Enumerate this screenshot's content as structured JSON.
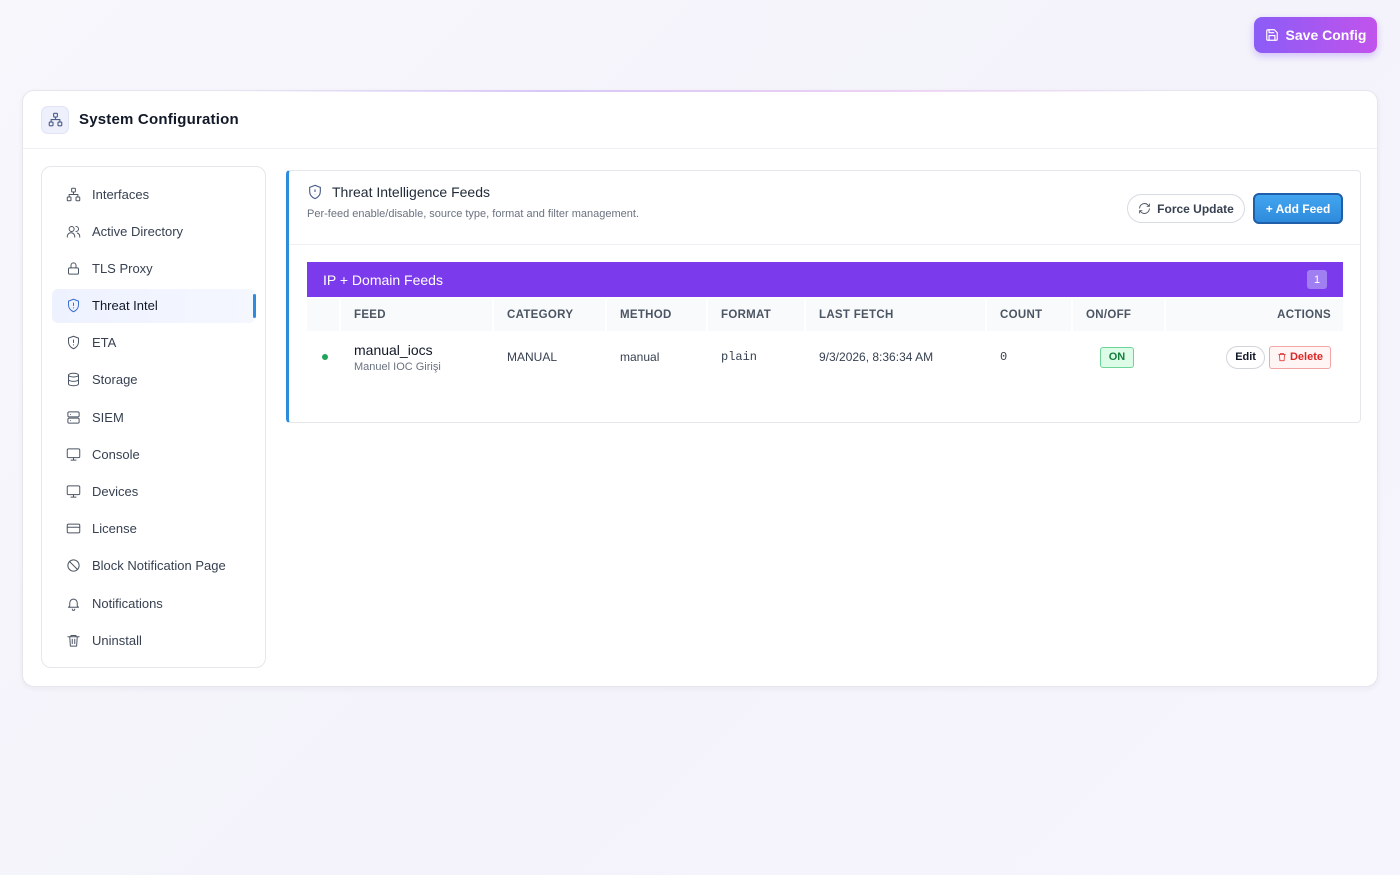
{
  "toolbar": {
    "save_label": "Save Config"
  },
  "card": {
    "title": "System Configuration"
  },
  "sidebar": {
    "items": [
      {
        "label": "Interfaces",
        "icon": "network-icon"
      },
      {
        "label": "Active Directory",
        "icon": "users-icon"
      },
      {
        "label": "TLS Proxy",
        "icon": "lock-icon"
      },
      {
        "label": "Threat Intel",
        "icon": "shield-icon",
        "active": true
      },
      {
        "label": "ETA",
        "icon": "shield-alert-icon"
      },
      {
        "label": "Storage",
        "icon": "database-icon"
      },
      {
        "label": "SIEM",
        "icon": "server-icon"
      },
      {
        "label": "Console",
        "icon": "monitor-icon"
      },
      {
        "label": "Devices",
        "icon": "monitor-icon"
      },
      {
        "label": "License",
        "icon": "credit-card-icon"
      },
      {
        "label": "Block Notification Page",
        "icon": "ban-icon"
      },
      {
        "label": "Notifications",
        "icon": "bell-icon"
      },
      {
        "label": "Uninstall",
        "icon": "trash-icon"
      }
    ]
  },
  "panel": {
    "title": "Threat Intelligence Feeds",
    "subtitle": "Per-feed enable/disable, source type, format and filter management.",
    "force_update_label": "Force Update",
    "add_feed_label": "+ Add Feed"
  },
  "feeds_group": {
    "title": "IP + Domain Feeds",
    "count": "1",
    "columns": [
      "FEED",
      "CATEGORY",
      "METHOD",
      "FORMAT",
      "LAST FETCH",
      "COUNT",
      "ON/OFF",
      "ACTIONS"
    ],
    "rows": [
      {
        "name": "manual_iocs",
        "description": "Manuel IOC Girişi",
        "category": "MANUAL",
        "method": "manual",
        "format": "plain",
        "last_fetch": "9/3/2026, 8:36:34 AM",
        "count": "0",
        "status": "ON",
        "edit_label": "Edit",
        "delete_label": "Delete"
      }
    ]
  },
  "colors": {
    "accent": "#7c3aed",
    "primary_blue": "#2f8bdc",
    "status_green": "#22a35a",
    "danger": "#dc2626"
  }
}
